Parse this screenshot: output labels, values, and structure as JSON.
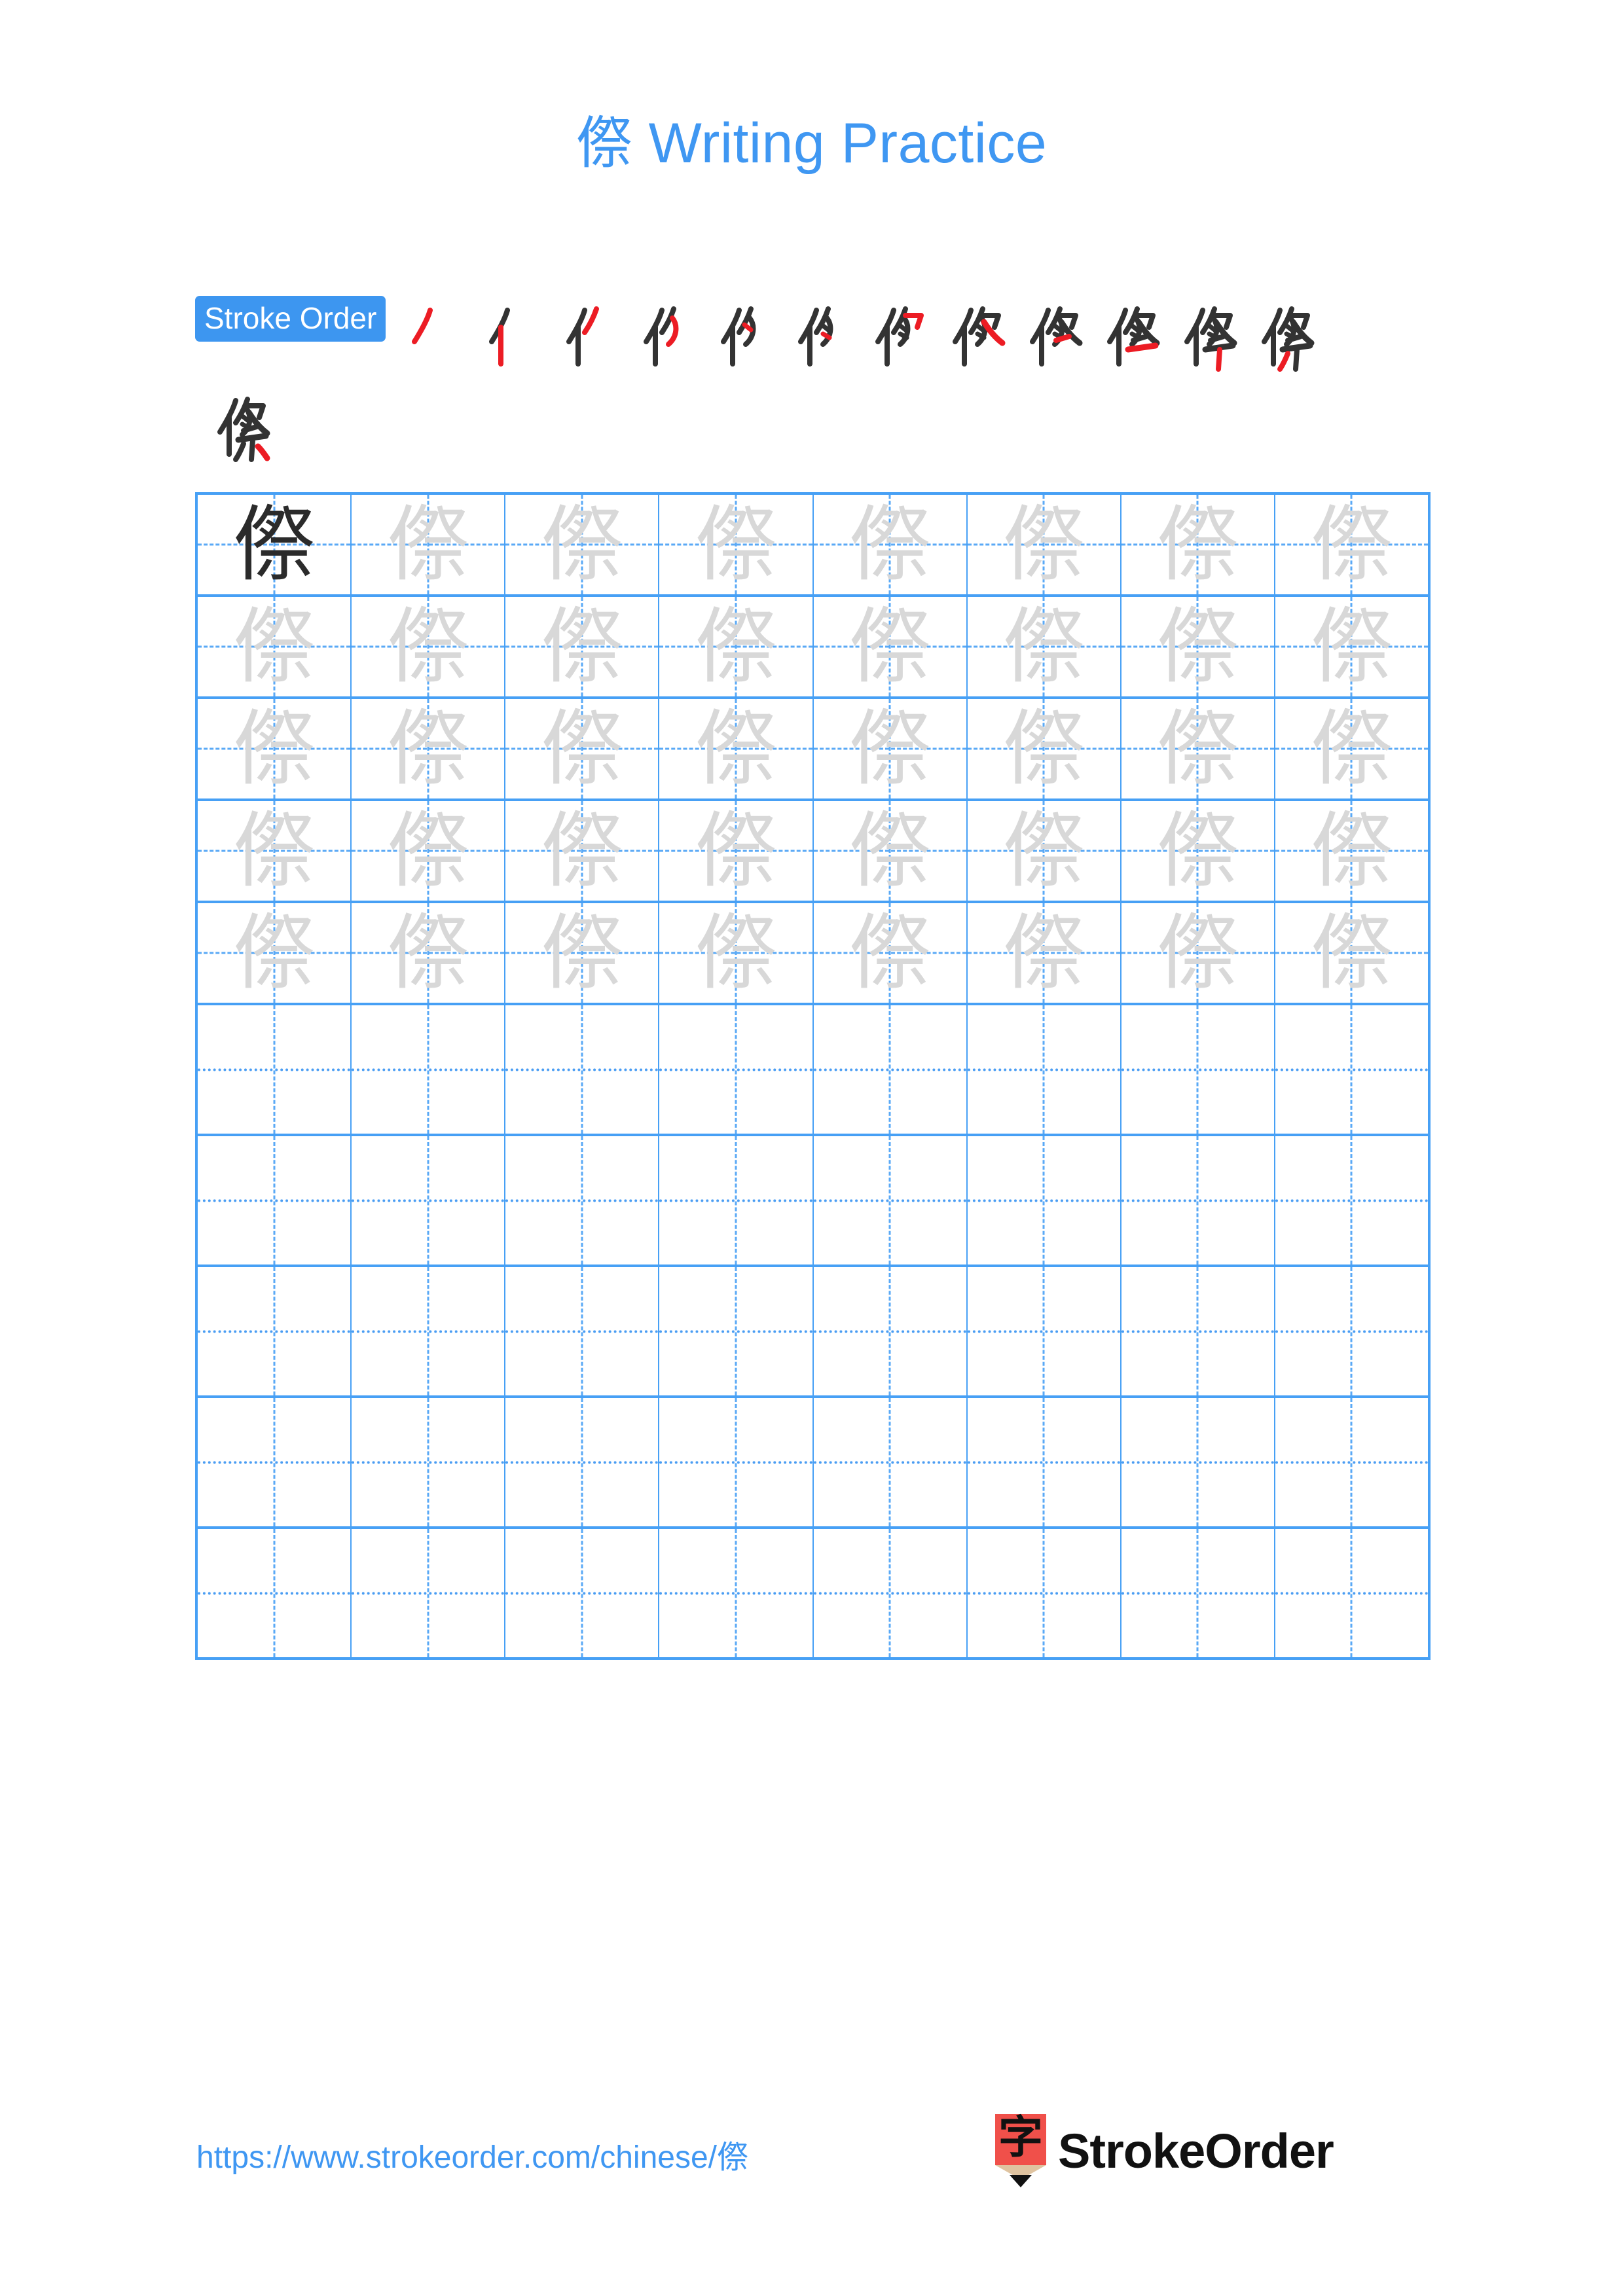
{
  "page": {
    "character": "傺",
    "title": "傺 Writing Practice",
    "background_color": "#ffffff",
    "accent_blue": "#3f97f2",
    "grid_line_color": "#47a0f5",
    "trace_gray": "#d8d8d8",
    "solid_ink": "#2b2b2b",
    "stroke_highlight_red": "#ec1c24"
  },
  "stroke_order": {
    "badge_label": "Stroke Order",
    "badge_bg": "#3d96f0",
    "badge_text_color": "#ffffff",
    "total_strokes": 13,
    "steps_row_1": 12,
    "steps_row_2": 1,
    "step_numbers": [
      1,
      2,
      3,
      4,
      5,
      6,
      7,
      8,
      9,
      10,
      11,
      12,
      13
    ]
  },
  "practice_grid": {
    "columns": 8,
    "total_rows": 10,
    "character_rows": 5,
    "blank_rows": 5,
    "model_character": "傺",
    "trace_character": "傺",
    "first_cell_is_solid": true,
    "row_types": [
      "char",
      "char",
      "char",
      "char",
      "char",
      "blank",
      "blank",
      "blank",
      "blank",
      "blank"
    ]
  },
  "footer": {
    "url": "https://www.strokeorder.com/chinese/傺",
    "url_color": "#3f97f2",
    "logo_text": "StrokeOrder",
    "logo_glyph": "字",
    "logo_body_color": "#f0504a",
    "logo_wood_color": "#dfc3a0",
    "logo_tip_color": "#111111"
  }
}
